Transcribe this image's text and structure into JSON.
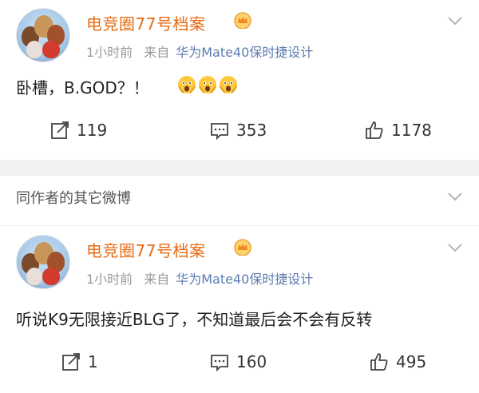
{
  "posts": [
    {
      "username": "电竞圈77号档案",
      "time": "1小时前",
      "source_prefix": "来自",
      "source": "华为Mate40保时捷设计",
      "text": "卧槽，B.GOD？！",
      "emojis": [
        "scared-face-emoji",
        "scared-face-emoji",
        "scared-face-emoji"
      ],
      "reposts": "119",
      "comments": "353",
      "likes": "1178"
    },
    {
      "username": "电竞圈77号档案",
      "time": "1小时前",
      "source_prefix": "来自",
      "source": "华为Mate40保时捷设计",
      "text": "听说K9无限接近BLG了，不知道最后会不会有反转",
      "reposts": "1",
      "comments": "160",
      "likes": "495"
    }
  ],
  "section": {
    "title": "同作者的其它微博"
  },
  "colors": {
    "username": "#e66a12",
    "source": "#5b7cae",
    "meta": "#9a9a9a",
    "divider": "#f2f2f2"
  }
}
